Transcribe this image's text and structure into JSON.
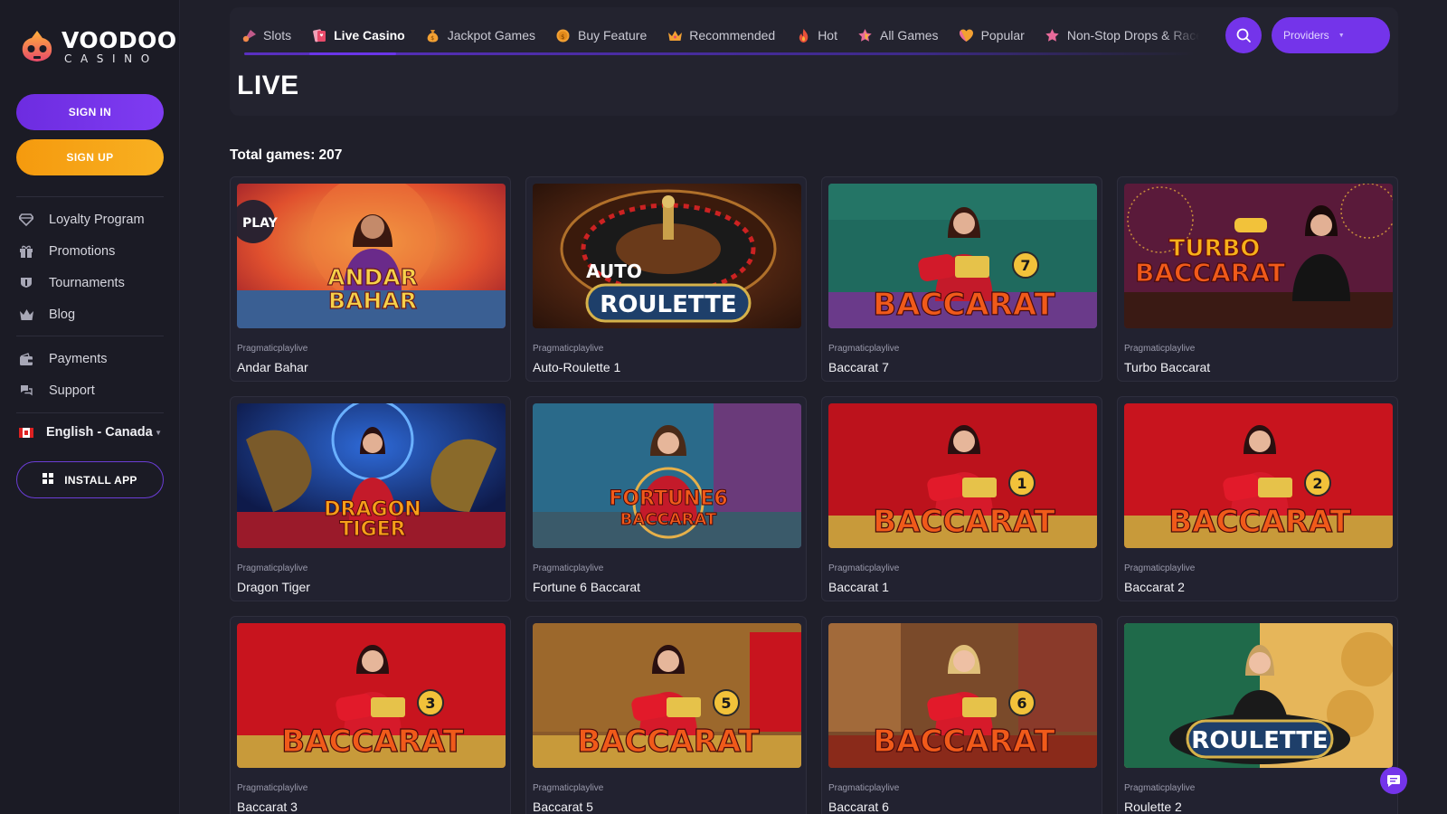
{
  "brand": {
    "name": "VOODOO",
    "sub": "CASINO"
  },
  "auth": {
    "sign_in": "SIGN IN",
    "sign_up": "SIGN UP"
  },
  "sidebar": {
    "items": [
      {
        "label": "Loyalty Program",
        "icon": "diamond-icon"
      },
      {
        "label": "Promotions",
        "icon": "gift-icon"
      },
      {
        "label": "Tournaments",
        "icon": "trophy-icon"
      },
      {
        "label": "Blog",
        "icon": "crown-icon"
      },
      {
        "label": "Payments",
        "icon": "wallet-icon"
      },
      {
        "label": "Support",
        "icon": "support-icon"
      }
    ],
    "language": "English - Canada",
    "install": "INSTALL APP"
  },
  "tabs": [
    {
      "label": "Slots",
      "icon": "cherry-icon",
      "active": false
    },
    {
      "label": "Live Casino",
      "icon": "cards-icon",
      "active": true
    },
    {
      "label": "Jackpot Games",
      "icon": "money-bag-icon",
      "active": false
    },
    {
      "label": "Buy Feature",
      "icon": "coin-icon",
      "active": false
    },
    {
      "label": "Recommended",
      "icon": "crown-icon",
      "active": false
    },
    {
      "label": "Hot",
      "icon": "fire-icon",
      "active": false
    },
    {
      "label": "All Games",
      "icon": "star-icon",
      "active": false
    },
    {
      "label": "Popular",
      "icon": "heart-icon",
      "active": false
    },
    {
      "label": "Non-Stop Drops & Races",
      "icon": "star-icon",
      "active": false
    }
  ],
  "providers_label": "Providers",
  "page_title": "LIVE",
  "total": {
    "label": "Total games:",
    "count": "207"
  },
  "games": [
    {
      "provider": "Pragmaticplaylive",
      "name": "Andar Bahar",
      "art": "ANDAR BAHAR"
    },
    {
      "provider": "Pragmaticplaylive",
      "name": "Auto-Roulette 1",
      "art": "AUTO ROULETTE"
    },
    {
      "provider": "Pragmaticplaylive",
      "name": "Baccarat 7",
      "art": "BACCARAT"
    },
    {
      "provider": "Pragmaticplaylive",
      "name": "Turbo Baccarat",
      "art": "TURBO BACCARAT"
    },
    {
      "provider": "Pragmaticplaylive",
      "name": "Dragon Tiger",
      "art": "DRAGON TIGER"
    },
    {
      "provider": "Pragmaticplaylive",
      "name": "Fortune 6 Baccarat",
      "art": "FORTUNE 6 BACCARAT"
    },
    {
      "provider": "Pragmaticplaylive",
      "name": "Baccarat 1",
      "art": "BACCARAT"
    },
    {
      "provider": "Pragmaticplaylive",
      "name": "Baccarat 2",
      "art": "BACCARAT"
    },
    {
      "provider": "Pragmaticplaylive",
      "name": "Baccarat 3",
      "art": "BACCARAT"
    },
    {
      "provider": "Pragmaticplaylive",
      "name": "Baccarat 5",
      "art": "BACCARAT"
    },
    {
      "provider": "Pragmaticplaylive",
      "name": "Baccarat 6",
      "art": "BACCARAT"
    },
    {
      "provider": "Pragmaticplaylive",
      "name": "Roulette 2",
      "art": "ROULETTE"
    }
  ],
  "colors": {
    "accent": "#7434ea",
    "signup": "#f5a012",
    "background": "#1f1f2a",
    "sidebar": "#1b1b25"
  }
}
